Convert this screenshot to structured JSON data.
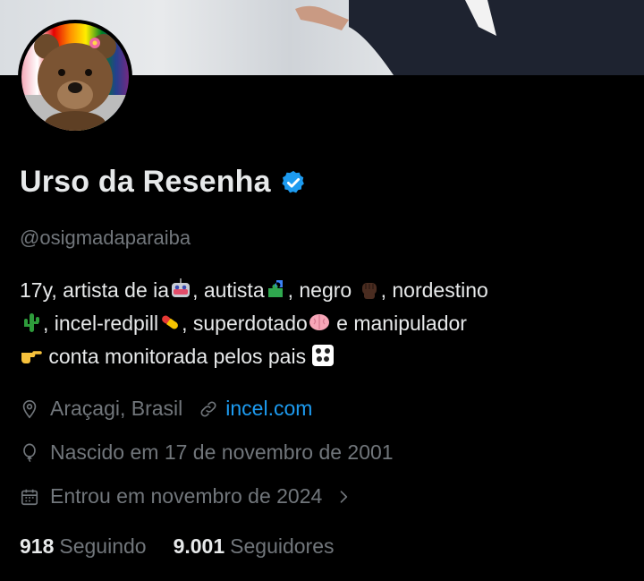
{
  "profile": {
    "name": "Urso da Resenha",
    "handle": "@osigmadaparaiba",
    "bio": {
      "seg1": "17y, artista de ia",
      "seg2": ", autista",
      "seg3": ", negro ",
      "seg4": ", nordestino",
      "seg5": ", incel-redpill",
      "seg6": ", superdotado",
      "seg7": " e manipulador",
      "seg8": " conta monitorada pelos pais "
    },
    "location": "Araçagi, Brasil",
    "website": "incel.com",
    "birth": "Nascido em 17 de novembro de 2001",
    "joined": "Entrou em novembro de 2024",
    "following_count": "918",
    "following_label": "Seguindo",
    "followers_count": "9.001",
    "followers_label": "Seguidores"
  },
  "icons": {
    "verified": "verified-badge-icon",
    "location": "location-pin-icon",
    "link": "link-icon",
    "birth": "balloon-icon",
    "calendar": "calendar-icon",
    "chevron": "chevron-right-icon"
  },
  "colors": {
    "accent": "#1d9bf0",
    "muted": "#71767b",
    "text": "#e7e9ea",
    "background": "#000000"
  }
}
